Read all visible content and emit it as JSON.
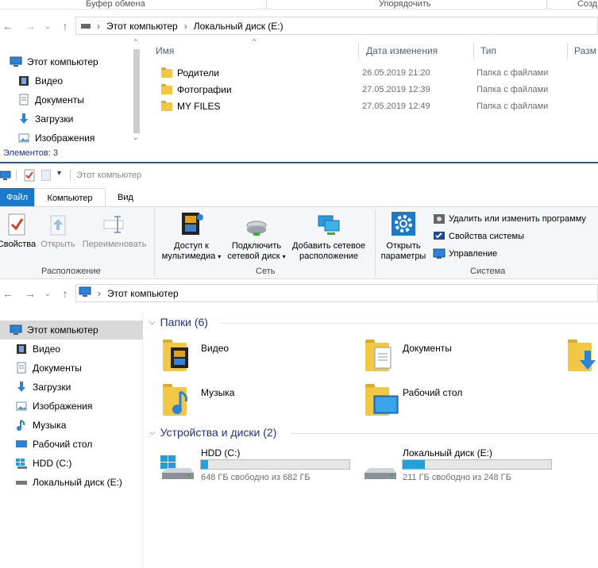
{
  "top_window": {
    "ribbon_groups": [
      "Буфер обмена",
      "Упорядочить",
      "Созд"
    ],
    "address_path": [
      "Этот компьютер",
      "Локальный диск (E:)"
    ],
    "columns": [
      "Имя",
      "Дата изменения",
      "Тип",
      "Разм"
    ],
    "files": [
      {
        "name": "Родители",
        "date": "26.05.2019 21:20",
        "type": "Папка с файлами"
      },
      {
        "name": "Фотографии",
        "date": "27.05.2019 12:39",
        "type": "Папка с файлами"
      },
      {
        "name": "MY FILES",
        "date": "27.05.2019 12:49",
        "type": "Папка с файлами"
      }
    ],
    "nav": [
      "Этот компьютер",
      "Видео",
      "Документы",
      "Загрузки",
      "Изображения"
    ],
    "status": "Элементов: 3"
  },
  "bottom_window": {
    "title": "Этот компьютер",
    "tabs": [
      "Файл",
      "Компьютер",
      "Вид"
    ],
    "ribbon": {
      "svoystva": "Свойства",
      "otkryt": "Открыть",
      "pereimenovat": "Переименовать",
      "grp_location": "Расположение",
      "media_1": "Доступ к",
      "media_2": "мультимедиа",
      "netdrive_1": "Подключить",
      "netdrive_2": "сетевой диск",
      "netloc_1": "Добавить сетевое",
      "netloc_2": "расположение",
      "grp_network": "Сеть",
      "params_1": "Открыть",
      "params_2": "параметры",
      "uninstall": "Удалить или изменить программу",
      "sysprops": "Свойства системы",
      "manage": "Управление",
      "grp_system": "Система"
    },
    "address": "Этот компьютер",
    "nav": [
      "Этот компьютер",
      "Видео",
      "Документы",
      "Загрузки",
      "Изображения",
      "Музыка",
      "Рабочий стол",
      "HDD (C:)",
      "Локальный диск (E:)"
    ],
    "folders_header": "Папки (6)",
    "folders": [
      "Видео",
      "Документы",
      "Музыка",
      "Рабочий стол"
    ],
    "drives_header": "Устройства и диски (2)",
    "drives": [
      {
        "name": "HDD (C:)",
        "free": "648 ГБ свободно из 682 ГБ",
        "used_fraction": 0.05
      },
      {
        "name": "Локальный диск (E:)",
        "free": "211 ГБ свободно из 248 ГБ",
        "used_fraction": 0.15
      }
    ]
  },
  "colors": {
    "accent": "#1979ca",
    "bar_fill": "#26a0da",
    "header_blue": "#1e3287"
  }
}
